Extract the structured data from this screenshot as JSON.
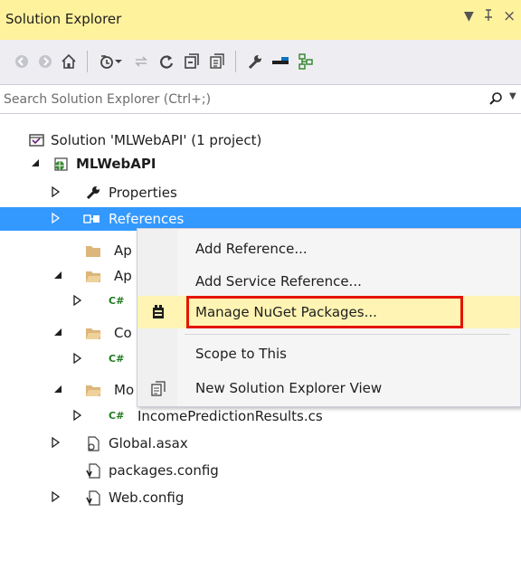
{
  "panel": {
    "title": "Solution Explorer",
    "dropdown_glyph": "▼",
    "pin_glyph": "ᵻ",
    "close_glyph": "×"
  },
  "toolbar": {
    "buttons": [
      "back-icon",
      "forward-icon",
      "home-icon",
      "pending-changes-icon",
      "sync-icon",
      "refresh-icon",
      "collapse-all-icon",
      "show-all-files-icon",
      "properties-icon",
      "preview-icon",
      "class-view-icon"
    ]
  },
  "search": {
    "placeholder": "Search Solution Explorer (Ctrl+;)",
    "value": ""
  },
  "tree": {
    "solution": "Solution 'MLWebAPI' (1 project)",
    "project": "MLWebAPI",
    "items": [
      {
        "label": "Properties"
      },
      {
        "label": "References"
      },
      {
        "label": "Ap"
      },
      {
        "label": "Ap"
      },
      {
        "label": ""
      },
      {
        "label": "Co"
      },
      {
        "label": ""
      },
      {
        "label": "Mo"
      },
      {
        "label": "IncomePredictionResults.cs"
      },
      {
        "label": "Global.asax"
      },
      {
        "label": "packages.config"
      },
      {
        "label": "Web.config"
      }
    ],
    "cs_glyph": "C#"
  },
  "context_menu": {
    "items": [
      {
        "label": "Add Reference..."
      },
      {
        "label": "Add Service Reference..."
      },
      {
        "label": "Manage NuGet Packages..."
      },
      {
        "label": "Scope to This"
      },
      {
        "label": "New Solution Explorer View"
      }
    ]
  },
  "colors": {
    "title_bg": "#fff29d",
    "selection": "#3399ff",
    "highlight_box": "#e51400",
    "menu_hover": "#fff4b3"
  }
}
